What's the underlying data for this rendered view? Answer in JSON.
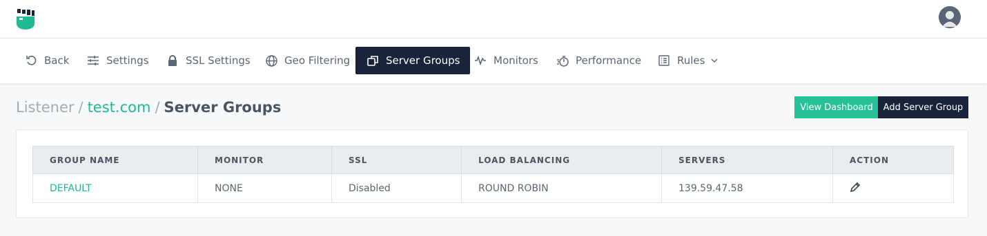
{
  "header": {
    "logo_icon": "fist-logo-icon",
    "avatar_icon": "user-avatar-icon",
    "brand_color": "#1fb992"
  },
  "nav": {
    "items": [
      {
        "label": "Back",
        "icon": "undo-icon"
      },
      {
        "label": "Settings",
        "icon": "sliders-icon"
      },
      {
        "label": "SSL Settings",
        "icon": "lock-icon"
      },
      {
        "label": "Geo Filtering",
        "icon": "globe-icon"
      },
      {
        "label": "Server Groups",
        "icon": "copy-windows-icon",
        "active": true
      },
      {
        "label": "Monitors",
        "icon": "pulse-icon"
      },
      {
        "label": "Performance",
        "icon": "stopwatch-icon"
      },
      {
        "label": "Rules",
        "icon": "list-icon",
        "dropdown": true
      }
    ],
    "active_color": "#19233a"
  },
  "breadcrumb": {
    "root": "Listener",
    "separator": "/",
    "middle": "test.com",
    "current": "Server Groups"
  },
  "actions": {
    "view_dashboard": "View Dashboard",
    "add_server_group": "Add Server Group"
  },
  "table": {
    "columns": [
      "GROUP NAME",
      "MONITOR",
      "SSL",
      "LOAD BALANCING",
      "SERVERS",
      "ACTION"
    ],
    "rows": [
      {
        "group_name": "DEFAULT",
        "monitor": "NONE",
        "ssl": "Disabled",
        "load_balancing": "ROUND ROBIN",
        "servers": "139.59.47.58",
        "action_icon": "pencil-edit-icon"
      }
    ]
  }
}
